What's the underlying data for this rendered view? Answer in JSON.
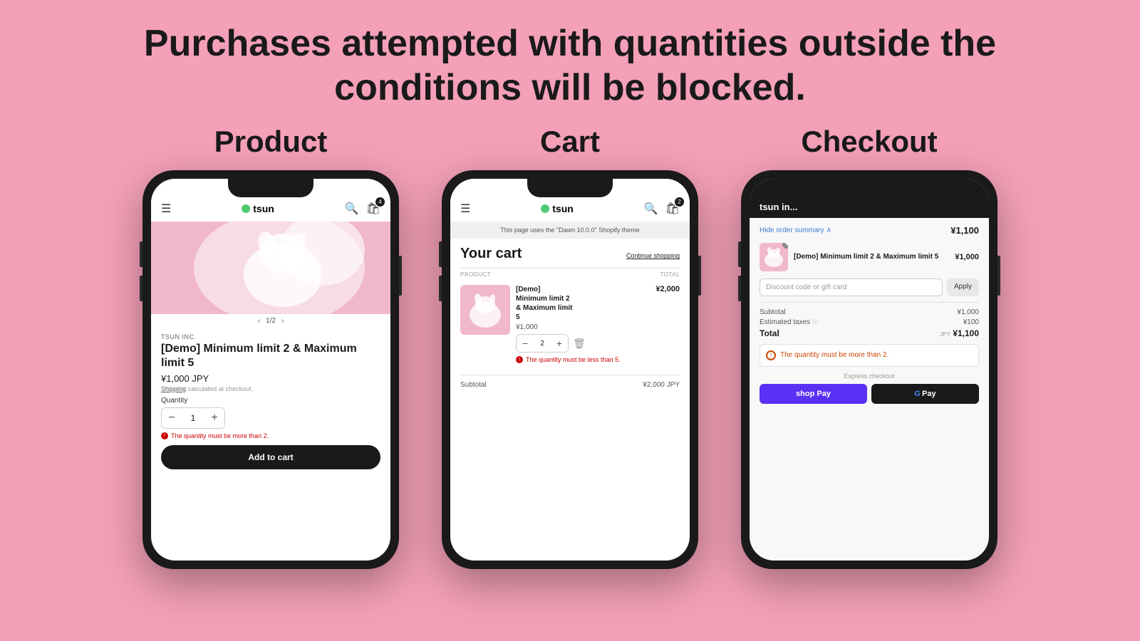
{
  "page": {
    "title_line1": "Purchases attempted with quantities outside the",
    "title_line2": "conditions will be blocked.",
    "background_color": "#f4a0b8"
  },
  "product_section": {
    "label": "Product",
    "nav": {
      "logo": "tsun",
      "logo_dot_color": "#4ecb71"
    },
    "image_slide": "1/2",
    "brand": "TSUN INC.",
    "product_name": "[Demo] Minimum limit 2 & Maximum limit 5",
    "price": "¥1,000 JPY",
    "shipping": "Shipping",
    "shipping_suffix": "calculated at checkout.",
    "quantity_label": "Quantity",
    "quantity_value": "1",
    "error_message": "The quantity must be more than 2.",
    "add_to_cart_label": "Add to cart"
  },
  "cart_section": {
    "label": "Cart",
    "nav": {
      "logo": "tsun"
    },
    "notice": "This page uses the \"Dawn 10.0.0\" Shopify theme",
    "title": "Your cart",
    "continue_shopping": "Continue shopping",
    "columns": {
      "product": "PRODUCT",
      "total": "TOTAL"
    },
    "item": {
      "name": "[Demo] Minimum limit 2 & Maximum limit 5",
      "price": "¥1,000",
      "quantity": "2",
      "total": "¥2,000"
    },
    "error_message": "The quantity must be less than 5.",
    "subtotal_label": "Subtotal",
    "subtotal_value": "¥2,000 JPY"
  },
  "checkout_section": {
    "label": "Checkout",
    "nav_logo": "tsun in...",
    "order_summary_label": "Hide order summary",
    "order_total": "¥1,100",
    "item": {
      "name": "[Demo] Minimum limit 2 & Maximum limit 5",
      "price": "¥1,000",
      "badge": "1"
    },
    "discount_placeholder": "Discount code or gift card",
    "apply_label": "Apply",
    "subtotal_label": "Subtotal",
    "subtotal_value": "¥1,000",
    "taxes_label": "Estimated taxes",
    "taxes_info": "ⓘ",
    "taxes_value": "¥100",
    "total_label": "Total",
    "total_currency": "JPY",
    "total_value": "¥1,100",
    "error_message": "The quantity must be more than 2.",
    "express_checkout_label": "Express checkout",
    "shop_pay_label": "shop Pay",
    "gpay_label": "G Pay"
  }
}
